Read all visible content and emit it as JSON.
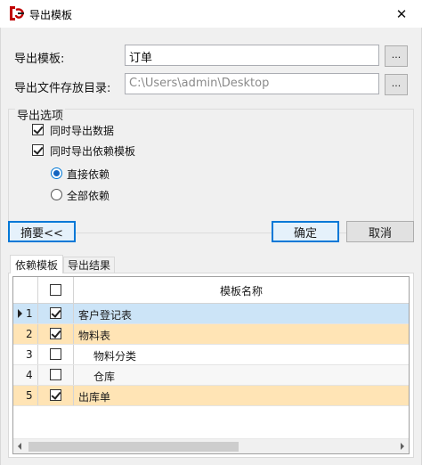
{
  "window": {
    "title": "导出模板"
  },
  "form": {
    "template_label": "导出模板:",
    "template_value": "订单",
    "dir_label": "导出文件存放目录:",
    "dir_value": "C:\\Users\\admin\\Desktop",
    "browse_label": "..."
  },
  "options": {
    "title": "导出选项",
    "export_data": {
      "label": "同时导出数据",
      "checked": true
    },
    "export_dependent": {
      "label": "同时导出依赖模板",
      "checked": true
    },
    "radio_direct": {
      "label": "直接依赖",
      "selected": true
    },
    "radio_all": {
      "label": "全部依赖",
      "selected": false
    }
  },
  "buttons": {
    "summary": "摘要<<",
    "ok": "确定",
    "cancel": "取消"
  },
  "tabs": [
    {
      "label": "依赖模板",
      "active": true
    },
    {
      "label": "导出结果",
      "active": false
    }
  ],
  "grid": {
    "column": "模板名称",
    "rows": [
      {
        "num": "1",
        "name": "客户登记表",
        "checked": true,
        "current": true,
        "indent": 0,
        "bg": "#cce4f7"
      },
      {
        "num": "2",
        "name": "物料表",
        "checked": true,
        "current": false,
        "indent": 0,
        "bg": "#ffe4b5"
      },
      {
        "num": "3",
        "name": "物料分类",
        "checked": false,
        "current": false,
        "indent": 1,
        "bg": "#ffffff"
      },
      {
        "num": "4",
        "name": "仓库",
        "checked": false,
        "current": false,
        "indent": 1,
        "bg": "#f7f7f7"
      },
      {
        "num": "5",
        "name": "出库单",
        "checked": true,
        "current": false,
        "indent": 0,
        "bg": "#ffe4b5"
      }
    ]
  },
  "colors": {
    "accent": "#0078d7",
    "selected_row": "#cce4f7",
    "highlight_row": "#ffe4b5"
  },
  "icons": {
    "app": "app-logo-icon",
    "close": "close-icon"
  }
}
